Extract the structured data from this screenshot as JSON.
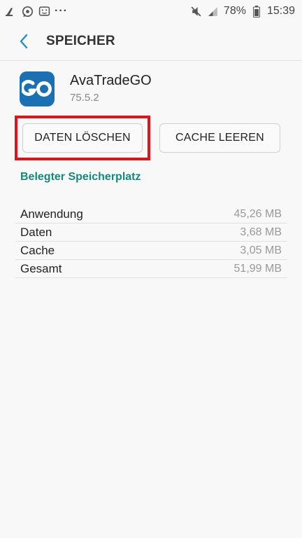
{
  "status_bar": {
    "left_icons": [
      "cleaner-icon",
      "whatsapp-icon",
      "message-icon"
    ],
    "more": "···",
    "battery_percent": "78%",
    "time": "15:39"
  },
  "header": {
    "title": "SPEICHER"
  },
  "app": {
    "name": "AvaTradeGO",
    "version": "75.5.2",
    "icon_text": "GO",
    "icon_color": "#1b6fb3"
  },
  "actions": {
    "clear_data": "DATEN LÖSCHEN",
    "clear_cache": "CACHE LEEREN"
  },
  "storage": {
    "section_title": "Belegter Speicherplatz",
    "rows": [
      {
        "label": "Anwendung",
        "value": "45,26 MB"
      },
      {
        "label": "Daten",
        "value": "3,68 MB"
      },
      {
        "label": "Cache",
        "value": "3,05 MB"
      },
      {
        "label": "Gesamt",
        "value": "51,99 MB"
      }
    ]
  },
  "colors": {
    "accent": "#15897a",
    "highlight": "#e0131b",
    "back_arrow": "#1f8fc8"
  }
}
